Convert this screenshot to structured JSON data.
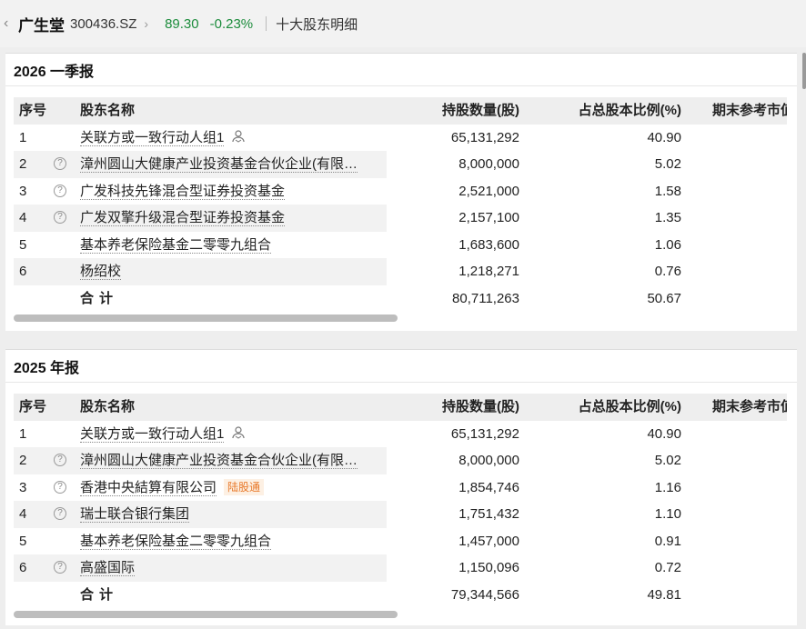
{
  "header": {
    "back_icon": "chevron-left-icon",
    "stock_name": "广生堂",
    "stock_code": "300436.SZ",
    "chevron": "›",
    "price": "89.30",
    "change": "-0.23%",
    "page_title": "十大股东明细",
    "price_color": "#1c8c3c"
  },
  "columns": {
    "idx": "序号",
    "name": "股东名称",
    "shares": "持股数量(股)",
    "ratio": "占总股本比例(%)",
    "mkt": "期末参考市值"
  },
  "sections": [
    {
      "title": "2026 一季报",
      "rows": [
        {
          "idx": "1",
          "q": "",
          "name": "关联方或一致行动人组1",
          "shares": "65,131,292",
          "ratio": "40.90",
          "tag": "",
          "user_icon": true
        },
        {
          "idx": "2",
          "q": "?",
          "name": "漳州圆山大健康产业投资基金合伙企业(有限…",
          "shares": "8,000,000",
          "ratio": "5.02",
          "tag": ""
        },
        {
          "idx": "3",
          "q": "?",
          "name": "广发科技先锋混合型证券投资基金",
          "shares": "2,521,000",
          "ratio": "1.58",
          "tag": ""
        },
        {
          "idx": "4",
          "q": "?",
          "name": "广发双擎升级混合型证券投资基金",
          "shares": "2,157,100",
          "ratio": "1.35",
          "tag": ""
        },
        {
          "idx": "5",
          "q": "",
          "name": "基本养老保险基金二零零九组合",
          "shares": "1,683,600",
          "ratio": "1.06",
          "tag": ""
        },
        {
          "idx": "6",
          "q": "",
          "name": "杨绍校",
          "shares": "1,218,271",
          "ratio": "0.76",
          "tag": ""
        }
      ],
      "total": {
        "label": "合计",
        "shares": "80,711,263",
        "ratio": "50.67"
      }
    },
    {
      "title": "2025 年报",
      "rows": [
        {
          "idx": "1",
          "q": "",
          "name": "关联方或一致行动人组1",
          "shares": "65,131,292",
          "ratio": "40.90",
          "tag": "",
          "user_icon": true
        },
        {
          "idx": "2",
          "q": "?",
          "name": "漳州圆山大健康产业投资基金合伙企业(有限…",
          "shares": "8,000,000",
          "ratio": "5.02",
          "tag": ""
        },
        {
          "idx": "3",
          "q": "?",
          "name": "香港中央結算有限公司",
          "shares": "1,854,746",
          "ratio": "1.16",
          "tag": "陆股通"
        },
        {
          "idx": "4",
          "q": "?",
          "name": "瑞士联合银行集团",
          "shares": "1,751,432",
          "ratio": "1.10",
          "tag": ""
        },
        {
          "idx": "5",
          "q": "",
          "name": "基本养老保险基金二零零九组合",
          "shares": "1,457,000",
          "ratio": "0.91",
          "tag": ""
        },
        {
          "idx": "6",
          "q": "?",
          "name": "高盛国际",
          "shares": "1,150,096",
          "ratio": "0.72",
          "tag": ""
        }
      ],
      "total": {
        "label": "合计",
        "shares": "79,344,566",
        "ratio": "49.81"
      }
    }
  ]
}
